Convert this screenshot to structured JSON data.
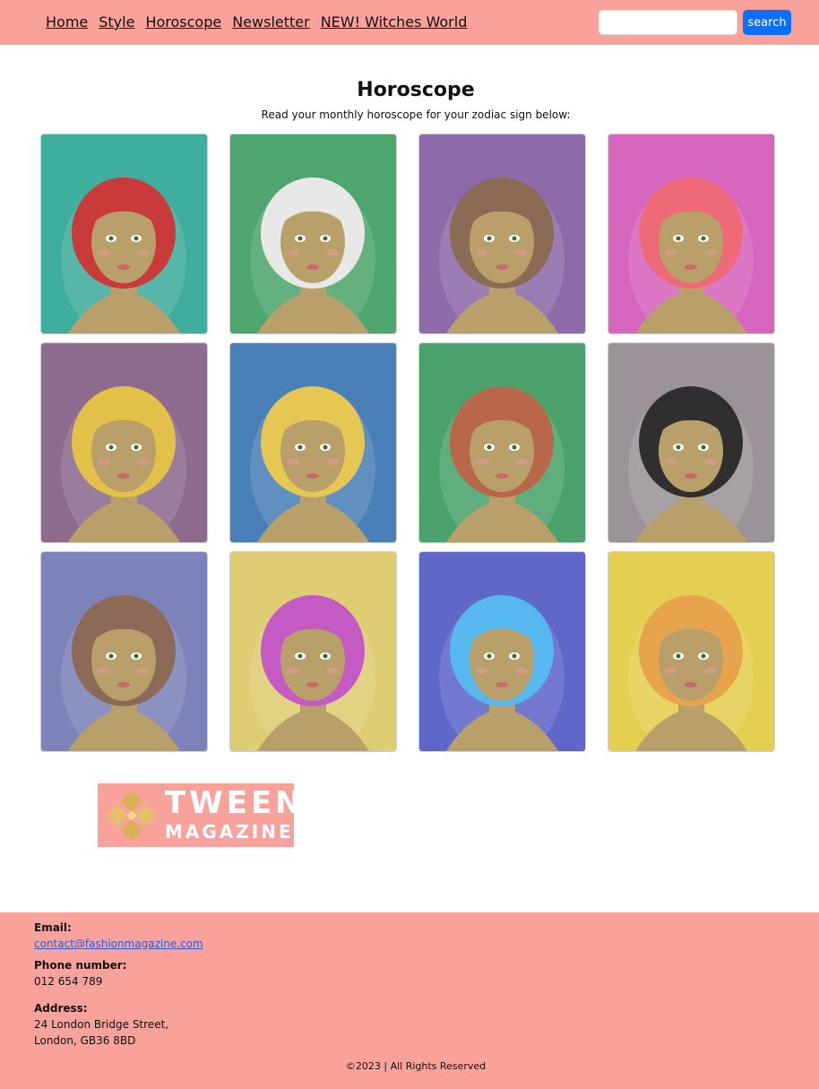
{
  "nav": {
    "items": [
      {
        "label": "Home"
      },
      {
        "label": "Style"
      },
      {
        "label": "Horoscope"
      },
      {
        "label": "Newsletter"
      },
      {
        "label": "NEW! Witches World"
      }
    ],
    "search": {
      "value": "",
      "placeholder": "",
      "button_label": "search"
    }
  },
  "main": {
    "title": "Horoscope",
    "intro": "Read your monthly horoscope for your zodiac sign below:"
  },
  "cards": [
    {
      "bg": "#3fae9e",
      "hair": "#c93b3a",
      "theme": "aries"
    },
    {
      "bg": "#4fa56e",
      "hair": "#e8e8e8",
      "theme": "taurus"
    },
    {
      "bg": "#8d6ba8",
      "hair": "#8b6b55",
      "theme": "gemini"
    },
    {
      "bg": "#d665bd",
      "hair": "#ef6a78",
      "theme": "cancer"
    },
    {
      "bg": "#8d6b8f",
      "hair": "#e3c047",
      "theme": "leo"
    },
    {
      "bg": "#4a80b8",
      "hair": "#e7c754",
      "theme": "virgo"
    },
    {
      "bg": "#4ba26c",
      "hair": "#b8674a",
      "theme": "libra"
    },
    {
      "bg": "#9b9399",
      "hair": "#2f2f2f",
      "theme": "scorpio"
    },
    {
      "bg": "#7d83b8",
      "hair": "#8b6b57",
      "theme": "sagittarius"
    },
    {
      "bg": "#dfcd73",
      "hair": "#c65ac5",
      "theme": "capricorn"
    },
    {
      "bg": "#5f67c9",
      "hair": "#56b8ee",
      "theme": "aquarius"
    },
    {
      "bg": "#e5cf50",
      "hair": "#e8a44d",
      "theme": "pisces"
    }
  ],
  "logo": {
    "line1": "TWEEN",
    "line2": "MAGAZINE",
    "bg": "#f9a19b",
    "accent": "#d9b055"
  },
  "footer": {
    "email_label": "Email:",
    "email": "contact@fashionmagazine.com",
    "phone_label": "Phone number:",
    "phone": "012 654 789",
    "address_label": "Address:",
    "address_line1": "24 London Bridge Street,",
    "address_line2": "London, GB36 8BD",
    "copyright": "©2023 | All Rights Reserved"
  },
  "colors": {
    "brand": "#f9a19b",
    "primary": "#0d6efd"
  }
}
